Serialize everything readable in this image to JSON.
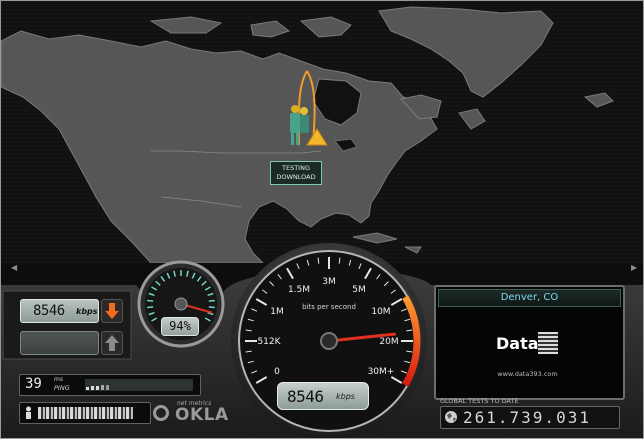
{
  "map": {
    "marker_label_line1": "TESTING",
    "marker_label_line2": "DOWNLOAD"
  },
  "left_panel": {
    "download_value": "8546",
    "download_unit": "kbps",
    "upload_value": "",
    "ping_value": "39",
    "ping_unit": "ms",
    "ping_label": "PING",
    "ip_address": "redacted"
  },
  "small_gauge": {
    "percent_text": "94%",
    "percent_fraction": 0.94
  },
  "main_gauge": {
    "center_label": "bits per second",
    "scale_labels": [
      "0",
      "512K",
      "1M",
      "1.5M",
      "3M",
      "5M",
      "10M",
      "20M",
      "30M+"
    ],
    "speed_value": "8546",
    "speed_unit": "kbps",
    "needle_scale_position": 6.8
  },
  "server": {
    "location": "Denver, CO",
    "host_name": "Data3",
    "host_url": "www.data393.com"
  },
  "brand": {
    "small_text": "net metrics",
    "name": "OKLA"
  },
  "global_tests": {
    "label": "GLOBAL TESTS TO DATE",
    "value": "261.739.031"
  },
  "colors": {
    "accent_orange": "#f26a1b",
    "lcd_green": "#b9c3c0",
    "location_cyan": "#7fd8ee",
    "needle_red": "#e0301e"
  },
  "icons": [
    "scroll-left-icon",
    "scroll-right-icon",
    "download-arrow-icon",
    "upload-arrow-icon",
    "user-icon",
    "globe-icon",
    "tester-figure-icon",
    "server-cone-icon"
  ]
}
